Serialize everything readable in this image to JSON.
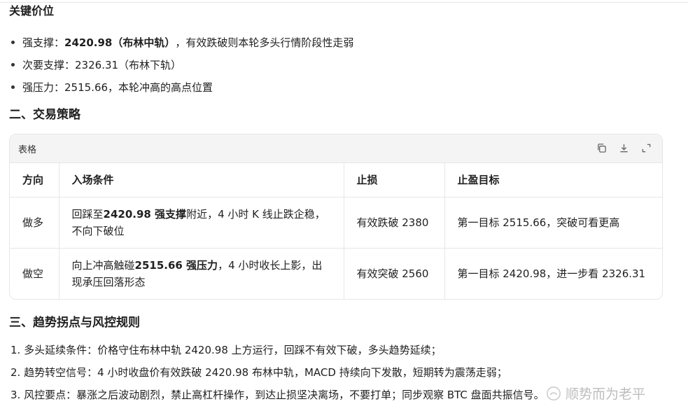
{
  "key_levels": {
    "title": "关键价位",
    "items": [
      {
        "prefix": "强支撑：",
        "bold": "2420.98（布林中轨）",
        "suffix": "，有效跌破则本轮多头行情阶段性走弱"
      },
      {
        "prefix": "次要支撑：",
        "bold": "",
        "suffix": "2326.31（布林下轨）"
      },
      {
        "prefix": "强压力：",
        "bold": "",
        "suffix": "2515.66，本轮冲高的高点位置"
      }
    ]
  },
  "section2": {
    "title": "二、交易策略"
  },
  "table": {
    "caption": "表格",
    "icons": [
      "copy-icon",
      "download-icon",
      "expand-icon"
    ],
    "headers": [
      "方向",
      "入场条件",
      "止损",
      "止盈目标"
    ],
    "rows": [
      {
        "direction": "做多",
        "entry_prefix": "回踩至",
        "entry_bold": "2420.98 强支撑",
        "entry_suffix": "附近，4 小时 K 线止跌企稳，不向下破位",
        "stop": "有效跌破 2380",
        "target": "第一目标 2515.66，突破可看更高"
      },
      {
        "direction": "做空",
        "entry_prefix": "向上冲高触碰",
        "entry_bold": "2515.66 强压力",
        "entry_suffix": "，4 小时收长上影，出现承压回落形态",
        "stop": "有效突破 2560",
        "target": "第一目标 2420.98，进一步看 2326.31"
      }
    ]
  },
  "section3": {
    "title": "三、趋势拐点与风控规则",
    "items": [
      "1. 多头延续条件：价格守住布林中轨 2420.98 上方运行，回踩不有效下破，多头趋势延续；",
      "2. 趋势转空信号：4 小时收盘价有效跌破 2420.98 布林中轨，MACD 持续向下发散，短期转为震荡走弱；",
      "3. 风控要点：暴涨之后波动剧烈，禁止高杠杆操作，到达止损坚决离场，不要打单；同步观察 BTC 盘面共振信号。"
    ]
  },
  "watermark": {
    "text": "顺势而为老平"
  }
}
